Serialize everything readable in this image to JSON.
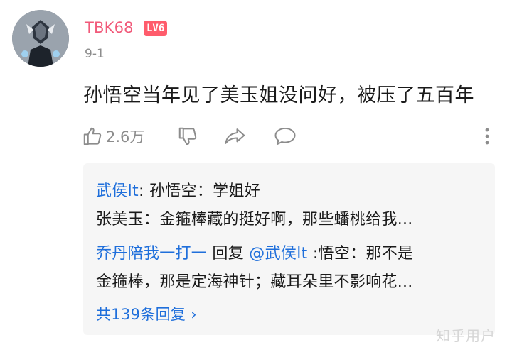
{
  "comment": {
    "username": "TBK68",
    "level_badge": "LV6",
    "date": "9-1",
    "text": "孙悟空当年见了美玉姐没问好，被压了五百年",
    "like_count": "2.6万"
  },
  "replies": {
    "line1": {
      "name": "武侯lt",
      "text": ": 孙悟空：学姐好"
    },
    "line2": {
      "text": "张美玉：金箍棒藏的挺好啊，那些蟠桃给我..."
    },
    "line3": {
      "name": "乔丹陪我一打一",
      "reply_word": " 回复 ",
      "target": "@武侯lt",
      "text": " :悟空：那不是"
    },
    "line4": {
      "text": "金箍棒，那是定海神针；藏耳朵里不影响花..."
    },
    "more_link": "共139条回复 ›"
  },
  "watermark": "知乎用户",
  "colors": {
    "username": "#f15a7a",
    "badge_bg": "#ff5c6c",
    "link_blue": "#1f6fdb",
    "muted": "#8c8c8c",
    "reply_bg": "#f6f6f6"
  },
  "icons": [
    "thumbs-up-icon",
    "thumbs-down-icon",
    "share-icon",
    "comment-icon",
    "more-vertical-icon"
  ]
}
